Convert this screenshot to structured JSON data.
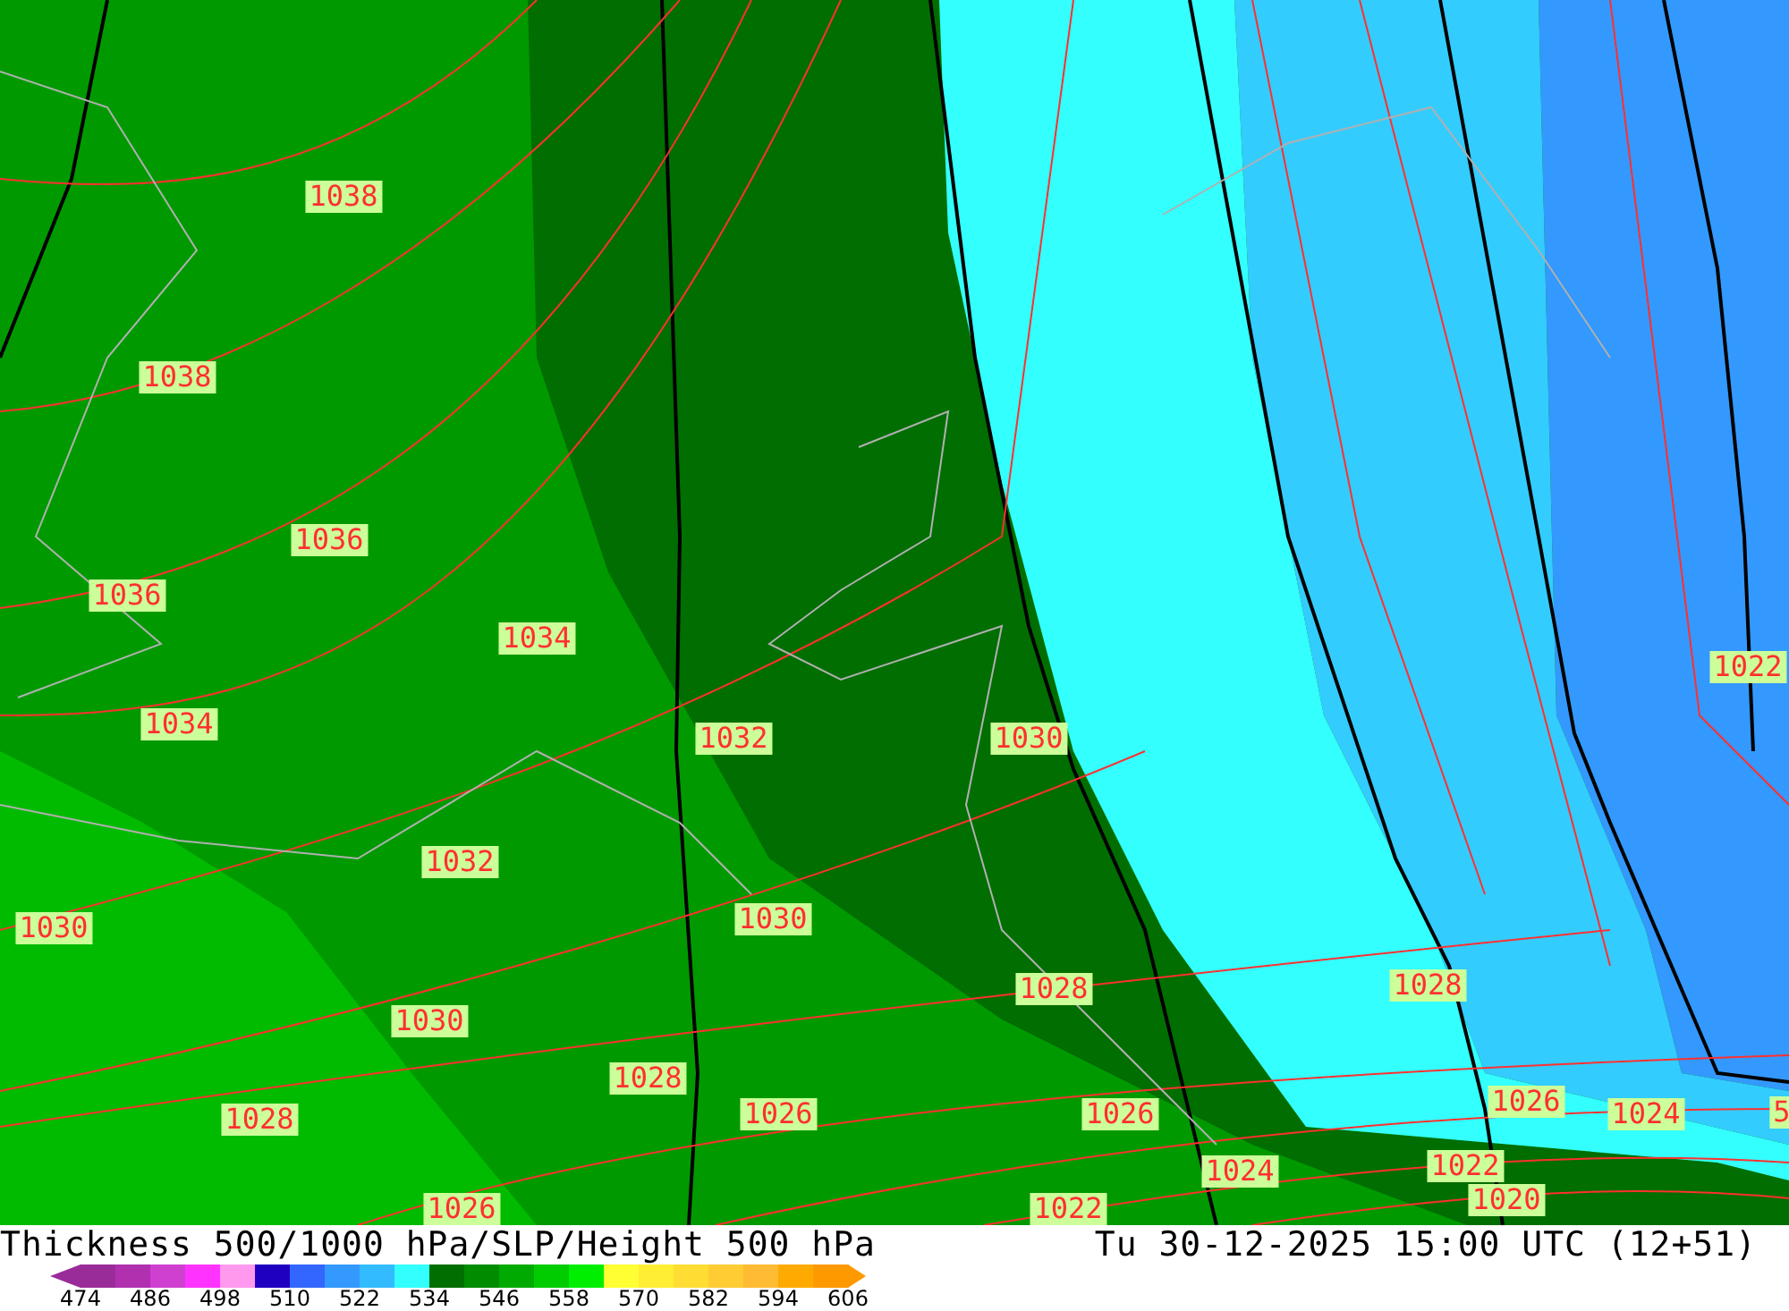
{
  "map": {
    "labels": [
      {
        "text": "1038"
      },
      {
        "text": "1038"
      },
      {
        "text": "1036"
      },
      {
        "text": "1036"
      },
      {
        "text": "1034"
      },
      {
        "text": "1034"
      },
      {
        "text": "1032"
      },
      {
        "text": "1030"
      },
      {
        "text": "1032"
      },
      {
        "text": "1030"
      },
      {
        "text": "1030"
      },
      {
        "text": "1028"
      },
      {
        "text": "1028"
      },
      {
        "text": "1030"
      },
      {
        "text": "1028"
      },
      {
        "text": "1028"
      },
      {
        "text": "1026"
      },
      {
        "text": "1026"
      },
      {
        "text": "1026"
      },
      {
        "text": "1024"
      },
      {
        "text": "1022"
      },
      {
        "text": "1024"
      },
      {
        "text": "1022"
      },
      {
        "text": "1020"
      },
      {
        "text": "1026"
      },
      {
        "text": "1022"
      },
      {
        "text": "5"
      }
    ]
  },
  "caption": {
    "title": "Thickness 500/1000 hPa/SLP/Height 500 hPa",
    "time": "Tu 30-12-2025 15:00 UTC (12+51)"
  },
  "legend": {
    "swatches": [
      {
        "color": "#9a2c9a"
      },
      {
        "color": "#b030b0"
      },
      {
        "color": "#d040d0"
      },
      {
        "color": "#ff33ff"
      },
      {
        "color": "#ff99ee"
      },
      {
        "color": "#2000c0"
      },
      {
        "color": "#3366ff"
      },
      {
        "color": "#3399ff"
      },
      {
        "color": "#33bbff"
      },
      {
        "color": "#33ffff"
      },
      {
        "color": "#006e00"
      },
      {
        "color": "#008c00"
      },
      {
        "color": "#00aa00"
      },
      {
        "color": "#00cc00"
      },
      {
        "color": "#00ee00"
      },
      {
        "color": "#ffff33"
      },
      {
        "color": "#ffee33"
      },
      {
        "color": "#ffdd33"
      },
      {
        "color": "#ffcc33"
      },
      {
        "color": "#ffbb33"
      },
      {
        "color": "#ffaa00"
      },
      {
        "color": "#ff9900"
      }
    ],
    "ticks": [
      "474",
      "486",
      "498",
      "510",
      "522",
      "534",
      "546",
      "558",
      "570",
      "582",
      "594",
      "606"
    ]
  }
}
